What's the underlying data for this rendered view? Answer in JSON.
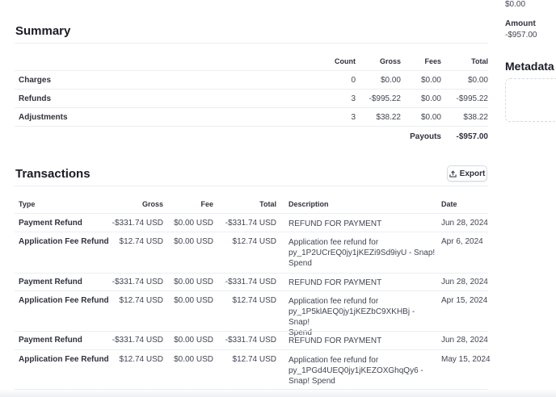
{
  "side": {
    "top_value": "$0.00",
    "amount_label": "Amount",
    "amount_value": "-$957.00",
    "metadata_title": "Metadata"
  },
  "summary": {
    "title": "Summary",
    "headers": {
      "count": "Count",
      "gross": "Gross",
      "fees": "Fees",
      "total": "Total"
    },
    "rows": [
      {
        "label": "Charges",
        "count": "0",
        "gross": "$0.00",
        "fees": "$0.00",
        "total": "$0.00"
      },
      {
        "label": "Refunds",
        "count": "3",
        "gross": "-$995.22",
        "fees": "$0.00",
        "total": "-$995.22"
      },
      {
        "label": "Adjustments",
        "count": "3",
        "gross": "$38.22",
        "fees": "$0.00",
        "total": "$38.22"
      }
    ],
    "payouts_label": "Payouts",
    "payouts_value": "-$957.00"
  },
  "transactions": {
    "title": "Transactions",
    "export_label": "Export",
    "headers": {
      "type": "Type",
      "gross": "Gross",
      "fee": "Fee",
      "total": "Total",
      "description": "Description",
      "date": "Date"
    },
    "rows": [
      {
        "type": "Payment Refund",
        "gross": "-$331.74 USD",
        "fee": "$0.00 USD",
        "total": "-$331.74 USD",
        "description": "REFUND FOR PAYMENT",
        "date": "Jun 28, 2024"
      },
      {
        "type": "Application Fee Refund",
        "gross": "$12.74 USD",
        "fee": "$0.00 USD",
        "total": "$12.74 USD",
        "description": "Application fee refund for\npy_1P2UCrEQ0jy1jKEZi9Sd9iyU - Snap!\nSpend",
        "date": "Apr 6, 2024"
      },
      {
        "type": "Payment Refund",
        "gross": "-$331.74 USD",
        "fee": "$0.00 USD",
        "total": "-$331.74 USD",
        "description": "REFUND FOR PAYMENT",
        "date": "Jun 28, 2024"
      },
      {
        "type": "Application Fee Refund",
        "gross": "$12.74 USD",
        "fee": "$0.00 USD",
        "total": "$12.74 USD",
        "description": "Application fee refund for\npy_1P5klAEQ0jy1jKEZbC9XKHBj - Snap!\nSpend",
        "date": "Apr 15, 2024"
      },
      {
        "type": "Payment Refund",
        "gross": "-$331.74 USD",
        "fee": "$0.00 USD",
        "total": "-$331.74 USD",
        "description": "REFUND FOR PAYMENT",
        "date": "Jun 28, 2024"
      },
      {
        "type": "Application Fee Refund",
        "gross": "$12.74 USD",
        "fee": "$0.00 USD",
        "total": "$12.74 USD",
        "description": "Application fee refund for\npy_1PGd4UEQ0jy1jKEZOXGhqQy6 -\nSnap! Spend",
        "date": "May 15, 2024"
      }
    ]
  }
}
